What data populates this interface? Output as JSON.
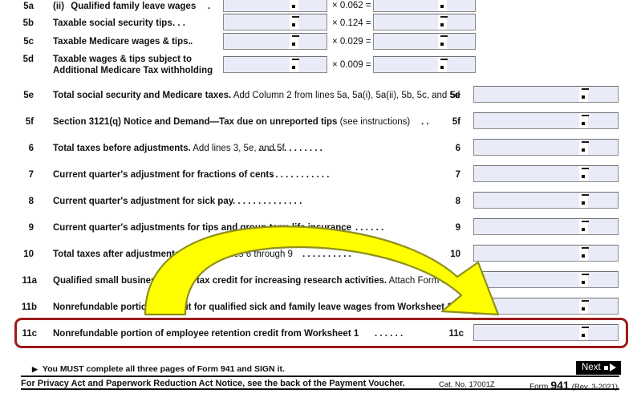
{
  "form": {
    "name": "Form 941",
    "revision": "(Rev. 3-2021)",
    "catalog": "Cat. No. 17001Z",
    "form_word": "Form",
    "form_number": "941"
  },
  "colors": {
    "field_fill": "#e9ecf8",
    "field_border": "#8a8a8a",
    "highlight_red": "#9d1c1c",
    "arrow_yellow": "#ffff00",
    "arrow_outline": "#8f8f1e",
    "text": "#111111"
  },
  "lines": [
    {
      "no": "5a",
      "prefix": "(ii)",
      "bold_text": "Qualified family leave wages",
      "reg_text": "",
      "dots": ".",
      "multiplier": "× 0.062 =",
      "col1": true,
      "col2": true
    },
    {
      "no": "5b",
      "prefix": "",
      "bold_text": "Taxable social security tips",
      "reg_text": "",
      "dots": ".   .   .",
      "multiplier": "× 0.124 =",
      "col1": true,
      "col2": true
    },
    {
      "no": "5c",
      "prefix": "",
      "bold_text": "Taxable Medicare wages & tips.",
      "reg_text": "",
      "dots": ".",
      "multiplier": "× 0.029 =",
      "col1": true,
      "col2": true
    },
    {
      "no": "5d",
      "prefix": "",
      "bold_text": "Taxable wages & tips subject to",
      "bold_text2": "Additional Medicare Tax withholding",
      "reg_text": "",
      "dots": "",
      "multiplier": "× 0.009 =",
      "col1": true,
      "col2": true
    }
  ],
  "right_lines": [
    {
      "no": "5e",
      "bold_text": "Total social security and Medicare taxes.",
      "reg_text": " Add Column 2 from lines 5a, 5a(i), 5a(ii), 5b, 5c, and 5d",
      "dots": "",
      "tag": "5e"
    },
    {
      "no": "5f",
      "bold_text": "Section 3121(q) Notice and Demand—Tax due on unreported tips",
      "reg_text": " (see instructions)",
      "dots": ".   .",
      "tag": "5f"
    },
    {
      "no": "6",
      "bold_text": "Total taxes before adjustments.",
      "reg_text": " Add lines 3, 5e, and 5f",
      "dots": ".   .   .   .   .   .   .   .   .   .   .   .   .",
      "tag": "6"
    },
    {
      "no": "7",
      "bold_text": "Current quarter's adjustment for fractions of cents",
      "reg_text": "",
      "dots": ".   .   .   .   .   .   .   .   .   .   .   .",
      "tag": "7"
    },
    {
      "no": "8",
      "bold_text": "Current quarter's adjustment for sick pay",
      "reg_text": "",
      "dots": ".   .   .   .   .   .   .   .   .   .   .   .   .   .",
      "tag": "8"
    },
    {
      "no": "9",
      "bold_text": "Current quarter's adjustments for tips and group-term life insurance",
      "reg_text": "",
      "dots": ".   .   .   .   .   .",
      "tag": "9"
    },
    {
      "no": "10",
      "bold_text": "Total taxes after adjustments.",
      "reg_text": " Combine lines 6 through 9",
      "dots": ".   .   .   .   .   .   .   .   .   .",
      "tag": "10"
    },
    {
      "no": "11a",
      "bold_text": "Qualified small business payroll tax credit for increasing research activities.",
      "reg_text": " Attach Form 8974",
      "dots": "",
      "tag": "11a"
    },
    {
      "no": "11b",
      "bold_text": "Nonrefundable portion of credit for qualified sick and family leave wages from Worksheet 1",
      "reg_text": "",
      "dots": "",
      "tag": "11b"
    }
  ],
  "highlighted_line": {
    "no": "11c",
    "bold_text": "Nonrefundable portion of employee retention credit from Worksheet 1",
    "dots": ".   .   .   .   .   .",
    "tag": "11c"
  },
  "footer": {
    "must_complete": "You MUST complete all three pages of Form 941 and SIGN it.",
    "privacy": "For Privacy Act and Paperwork Reduction Act Notice, see the back of the Payment Voucher.",
    "next_label": "Next"
  }
}
